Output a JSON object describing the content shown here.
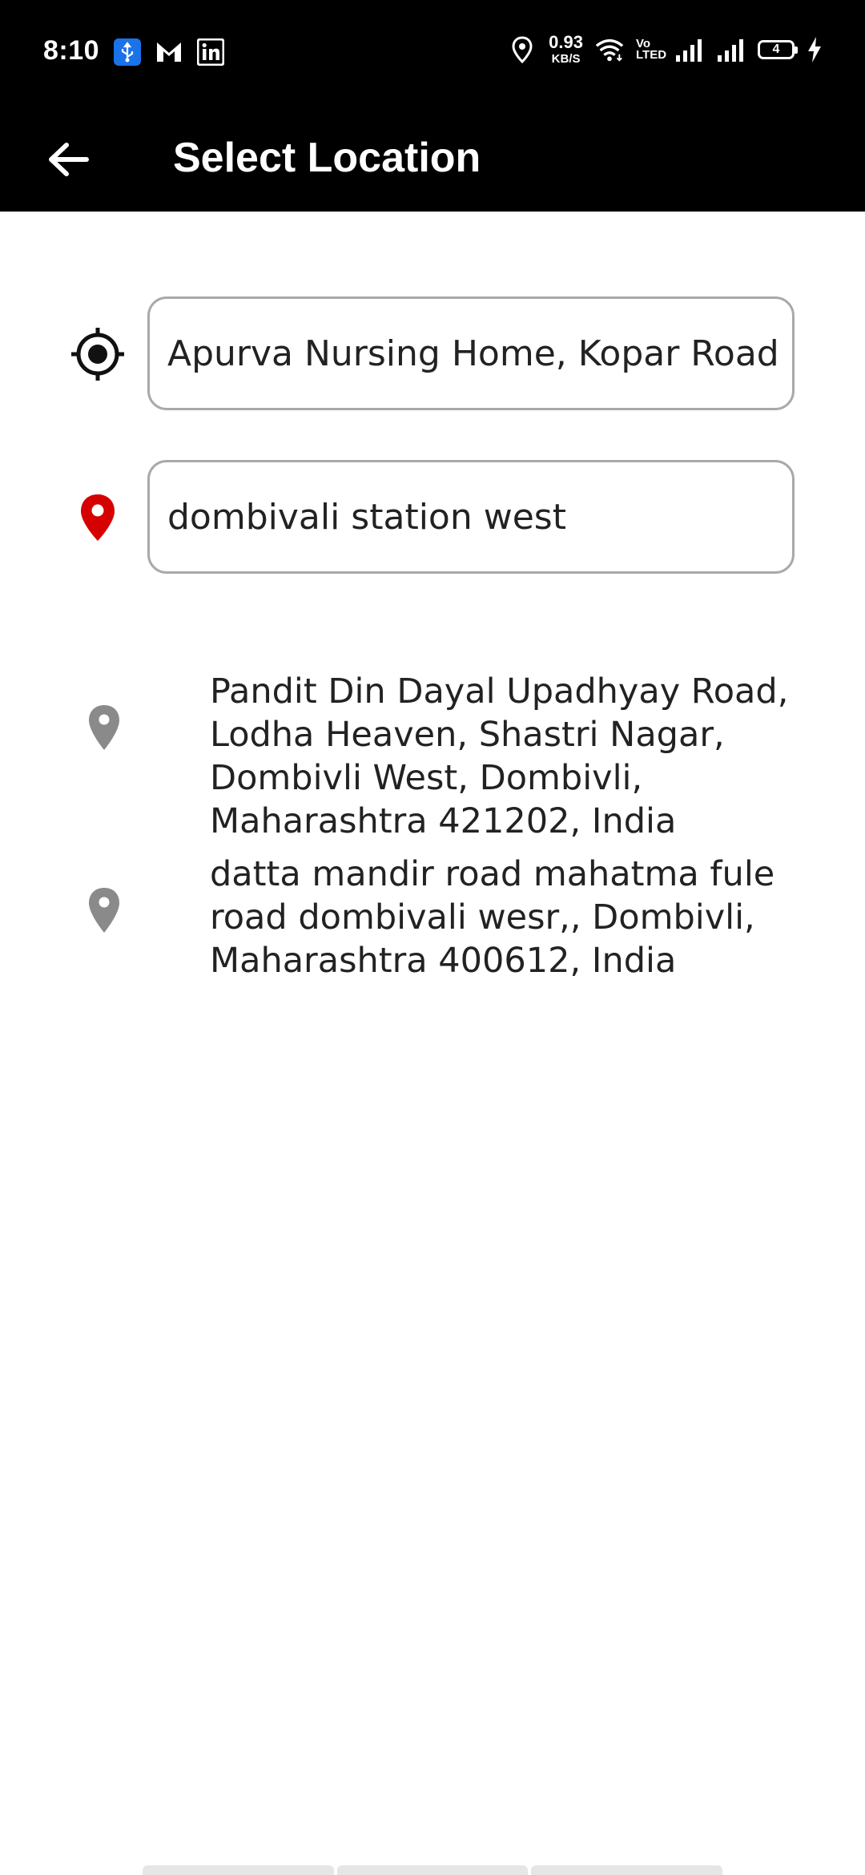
{
  "status_bar": {
    "time": "8:10",
    "net_speed_value": "0.93",
    "net_speed_unit": "KB/S",
    "volte_line1": "Vo",
    "volte_line2": "LTED",
    "battery_level": "4",
    "left_icons": [
      "usb-icon",
      "mail-icon",
      "linkedin-icon"
    ],
    "right_icons": [
      "location-icon",
      "wifi-icon",
      "signal-icon",
      "signal-icon",
      "charging-icon"
    ]
  },
  "app_bar": {
    "title": "Select Location",
    "back_icon": "arrow-left-icon"
  },
  "pickup": {
    "icon": "my-location-icon",
    "value": "Apurva Nursing Home, Kopar Road"
  },
  "destination": {
    "icon": "pin-icon",
    "icon_color": "#d50000",
    "value": "dombivali station west"
  },
  "suggestions": [
    {
      "icon": "pin-icon",
      "text": "Pandit Din Dayal Upadhyay Road, Lodha Heaven, Shastri Nagar, Dombivli West, Dombivli, Maharashtra 421202, India"
    },
    {
      "icon": "pin-icon",
      "text": "datta mandir road mahatma fule road dombivali wesr,, Dombivli, Maharashtra 400612, India"
    }
  ],
  "colors": {
    "app_bar": "#000000",
    "text": "#222222",
    "field_border": "#a9a9a9",
    "suggestion_pin": "#8a8a8a",
    "destination_pin": "#d50000"
  }
}
